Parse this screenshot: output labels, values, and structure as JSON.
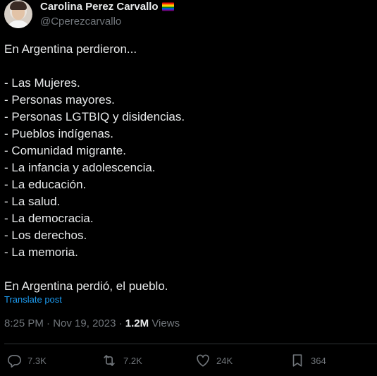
{
  "author": {
    "display_name": "Carolina Perez Carvallo",
    "handle": "@Cperezcarvallo",
    "badge_icon": "rainbow-flag-icon"
  },
  "tweet": {
    "lines": [
      "En Argentina perdieron...",
      "",
      "- Las Mujeres.",
      "- Personas mayores.",
      "- Personas LGTBIQ y disidencias.",
      "- Pueblos indígenas.",
      "- Comunidad migrante.",
      "- La infancia y adolescencia.",
      "- La educación.",
      "- La salud.",
      "- La democracia.",
      "- Los derechos.",
      "- La memoria.",
      "",
      "En Argentina perdió, el pueblo."
    ],
    "translate_label": "Translate post"
  },
  "meta": {
    "time": "8:25 PM",
    "separator": " · ",
    "date": "Nov 19, 2023",
    "views_count": "1.2M",
    "views_label": " Views"
  },
  "actions": {
    "replies": "7.3K",
    "reposts": "7.2K",
    "likes": "24K",
    "bookmarks": "364"
  },
  "colors": {
    "background": "#000000",
    "text": "#e7e9ea",
    "secondary": "#71767b",
    "link": "#1d9bf0",
    "divider": "#2f3336"
  }
}
